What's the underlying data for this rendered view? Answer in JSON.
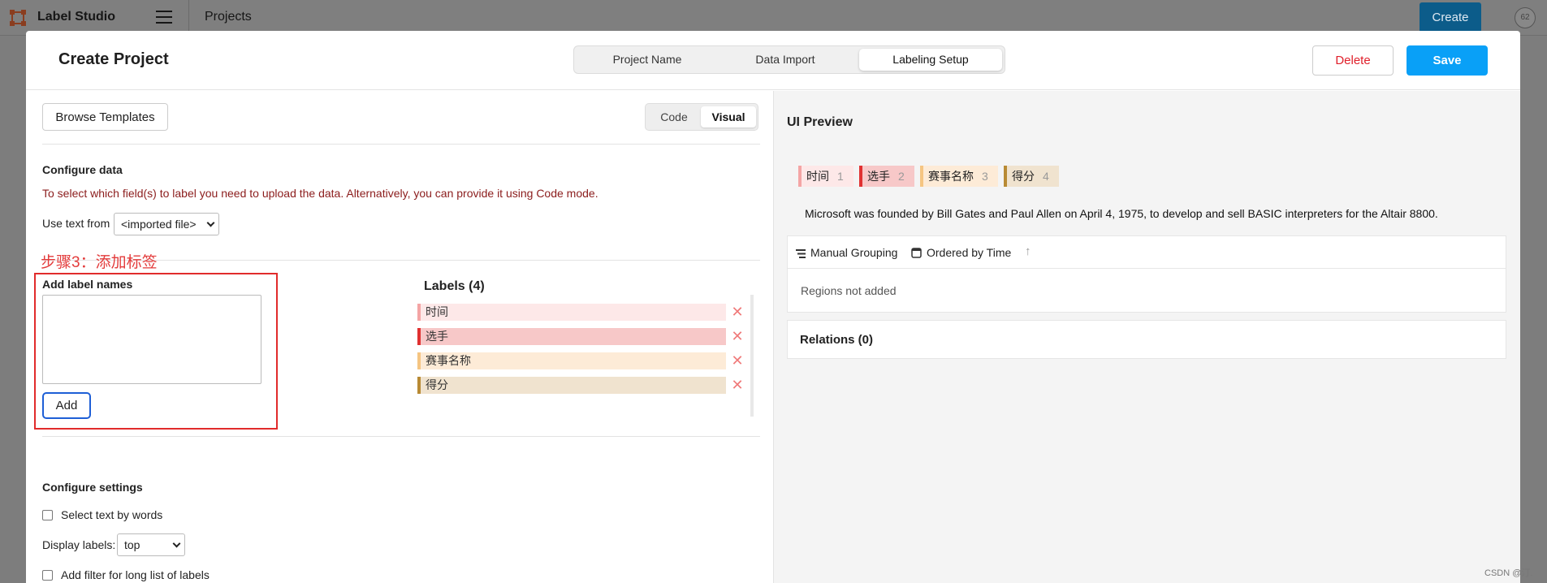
{
  "topbar": {
    "app_title": "Label Studio",
    "breadcrumb": "Projects",
    "create_label": "Create",
    "avatar_text": "62"
  },
  "modal": {
    "title": "Create Project",
    "steps": [
      "Project Name",
      "Data Import",
      "Labeling Setup"
    ],
    "active_step": "Labeling Setup",
    "delete_label": "Delete",
    "save_label": "Save"
  },
  "left": {
    "browse_templates": "Browse Templates",
    "modes": [
      "Code",
      "Visual"
    ],
    "active_mode": "Visual",
    "configure_data_title": "Configure data",
    "configure_data_warning": "To select which field(s) to label you need to upload the data. Alternatively, you can provide it using Code mode.",
    "use_text_from_label": "Use text from",
    "use_text_from_value": "<imported file>",
    "step_annotation": "步骤3：添加标签",
    "add_label_names_title": "Add label names",
    "add_button": "Add",
    "labels_heading": "Labels (4)",
    "labels": [
      {
        "name": "时间",
        "color": "#f4a5a5",
        "bg": "#fde8e8"
      },
      {
        "name": "选手",
        "color": "#e03131",
        "bg": "#f7c8c8"
      },
      {
        "name": "赛事名称",
        "color": "#f5c582",
        "bg": "#fdebd7"
      },
      {
        "name": "得分",
        "color": "#b88a34",
        "bg": "#f0e3cf"
      }
    ],
    "configure_settings_title": "Configure settings",
    "select_by_words": "Select text by words",
    "display_labels_label": "Display labels:",
    "display_labels_value": "top",
    "filter_long_list": "Add filter for long list of labels"
  },
  "right": {
    "ui_preview_title": "UI Preview",
    "chips": [
      {
        "name": "时间",
        "hotkey": "1",
        "color": "#f4a5a5",
        "bg": "#fde8e8"
      },
      {
        "name": "选手",
        "hotkey": "2",
        "color": "#e03131",
        "bg": "#f7c8c8"
      },
      {
        "name": "赛事名称",
        "hotkey": "3",
        "color": "#f5c582",
        "bg": "#fdebd7"
      },
      {
        "name": "得分",
        "hotkey": "4",
        "color": "#b88a34",
        "bg": "#f0e3cf"
      }
    ],
    "sample_text": "Microsoft was founded by Bill Gates and Paul Allen on April 4, 1975, to develop and sell BASIC interpreters for the Altair 8800.",
    "manual_grouping": "Manual Grouping",
    "ordered_by_time": "Ordered by Time",
    "regions_empty": "Regions not added",
    "relations_title": "Relations (0)"
  },
  "watermark": "CSDN @汀."
}
